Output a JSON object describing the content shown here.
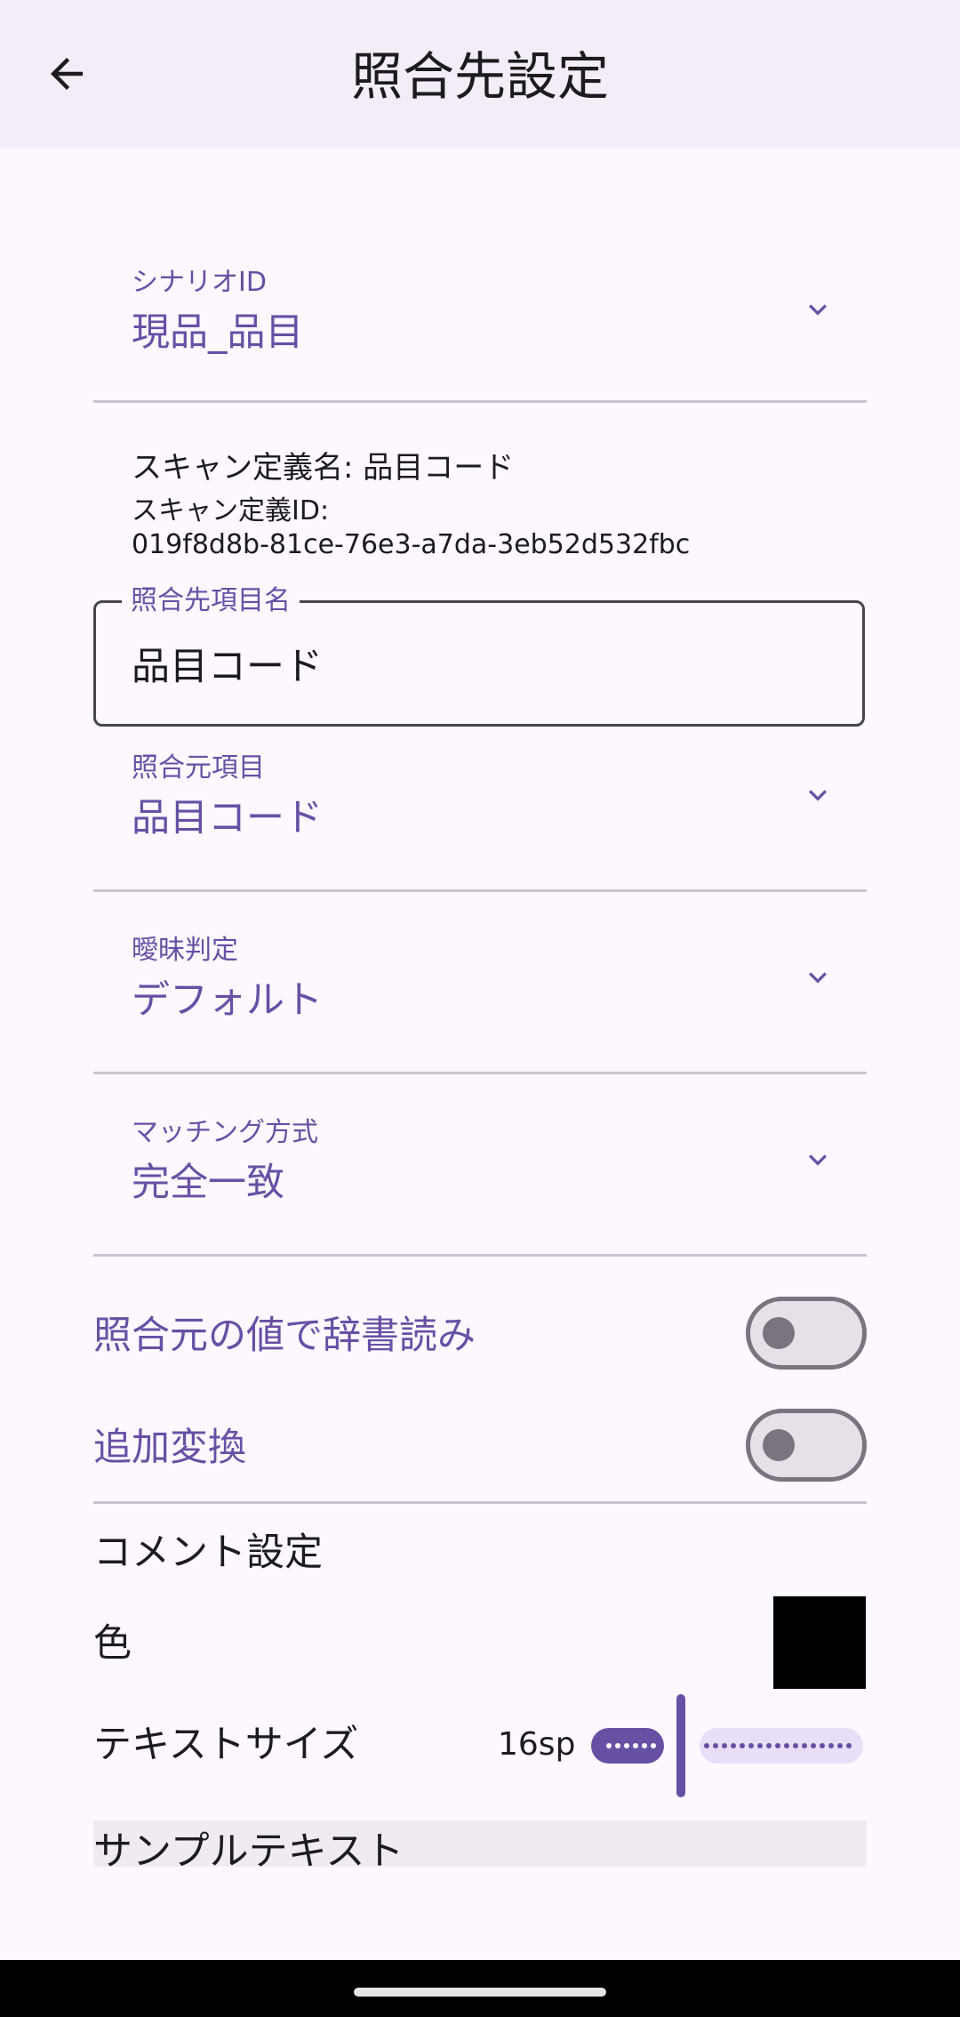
{
  "appbar": {
    "title": "照合先設定",
    "back_icon": "arrow-back-icon"
  },
  "scenario": {
    "label": "シナリオID",
    "value": "現品_品目"
  },
  "scan_info": {
    "name_line": "スキャン定義名: 品目コード",
    "id_label": "スキャン定義ID:",
    "id_value": "019f8d8b-81ce-76e3-a7da-3eb52d532fbc"
  },
  "target_item": {
    "label": "照合先項目名",
    "value": "品目コード"
  },
  "source_item": {
    "label": "照合元項目",
    "value": "品目コード"
  },
  "fuzzy": {
    "label": "曖昧判定",
    "value": "デフォルト"
  },
  "matching": {
    "label": "マッチング方式",
    "value": "完全一致"
  },
  "toggles": {
    "dictionary": {
      "label": "照合元の値で辞書読み",
      "on": false
    },
    "extra_convert": {
      "label": "追加変換",
      "on": false
    }
  },
  "comment": {
    "section_title": "コメント設定",
    "color_label": "色",
    "color_value": "#000000",
    "text_size_label": "テキストサイズ",
    "text_size_value": "16sp",
    "sample_text": "サンプルテキスト"
  },
  "colors": {
    "accent": "#6750a4",
    "surface": "#fdf7ff",
    "appbar": "#f3edf7"
  }
}
